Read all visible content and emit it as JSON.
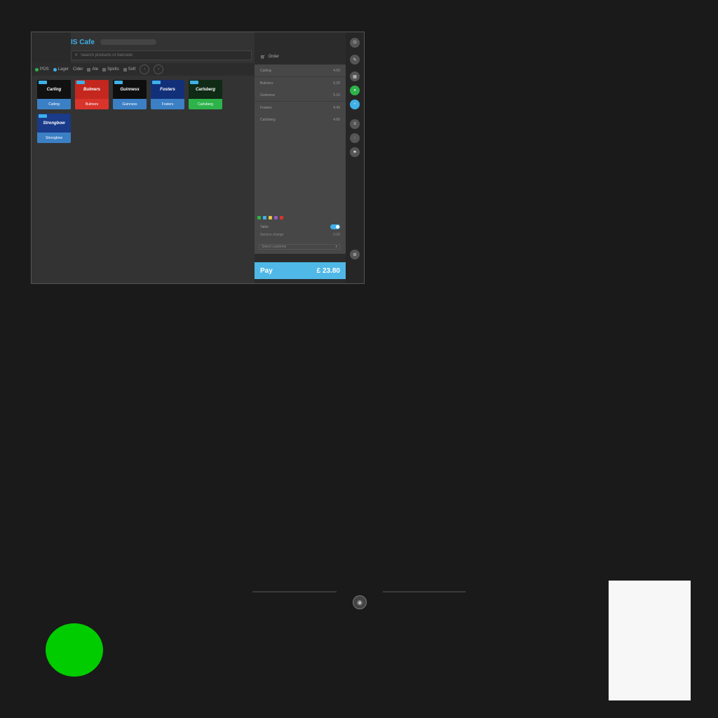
{
  "app": {
    "title": "IS Cafe"
  },
  "search": {
    "placeholder": "Search products or barcode"
  },
  "tabs": [
    {
      "label": "POS",
      "active": true
    },
    {
      "label": "Lager",
      "active": false
    },
    {
      "label": "Cider",
      "active": false
    },
    {
      "label": "Ale",
      "active": false
    },
    {
      "label": "Spirits",
      "active": false
    },
    {
      "label": "Soft",
      "active": false
    }
  ],
  "products": [
    {
      "name": "Carling",
      "label": "Carling",
      "color": "#3b7fc4",
      "bg": "#111111"
    },
    {
      "name": "Bulmers",
      "label": "Bulmers",
      "color": "#d9342b",
      "bg": "#c3271e"
    },
    {
      "name": "Guinness",
      "label": "Guinness",
      "color": "#3b7fc4",
      "bg": "#0e0e0e"
    },
    {
      "name": "Fosters",
      "label": "Fosters",
      "color": "#3b7fc4",
      "bg": "#12307a"
    },
    {
      "name": "Carlsberg",
      "label": "Carlsberg",
      "color": "#2db34a",
      "bg": "#0f2a15"
    },
    {
      "name": "Strongbow",
      "label": "Strongbow",
      "color": "#3b7fc4",
      "bg": "#1a3a8a"
    }
  ],
  "order": {
    "header": "Order",
    "lines": [
      {
        "name": "Carling",
        "price": "4.50"
      },
      {
        "name": "Bulmers",
        "price": "5.20"
      },
      {
        "name": "Guinness",
        "price": "5.10"
      },
      {
        "name": "Fosters",
        "price": "4.40"
      },
      {
        "name": "Carlsberg",
        "price": "4.60"
      }
    ]
  },
  "options": {
    "toggle_label": "Table",
    "sub_label": "Service charge",
    "sub_value": "0.00",
    "dropdown": "Select customer"
  },
  "pay": {
    "label": "Pay",
    "amount": "£ 23.80"
  },
  "colors": {
    "accent": "#3fb0e8",
    "pay": "#4fb8e6",
    "green": "#2db34a",
    "bg": "#1a1a1a"
  },
  "icons": [
    "power-icon",
    "edit-icon",
    "grid-icon",
    "user-icon",
    "user-add-icon",
    "receipt-icon",
    "chat-icon",
    "flag-icon",
    "settings-icon"
  ]
}
